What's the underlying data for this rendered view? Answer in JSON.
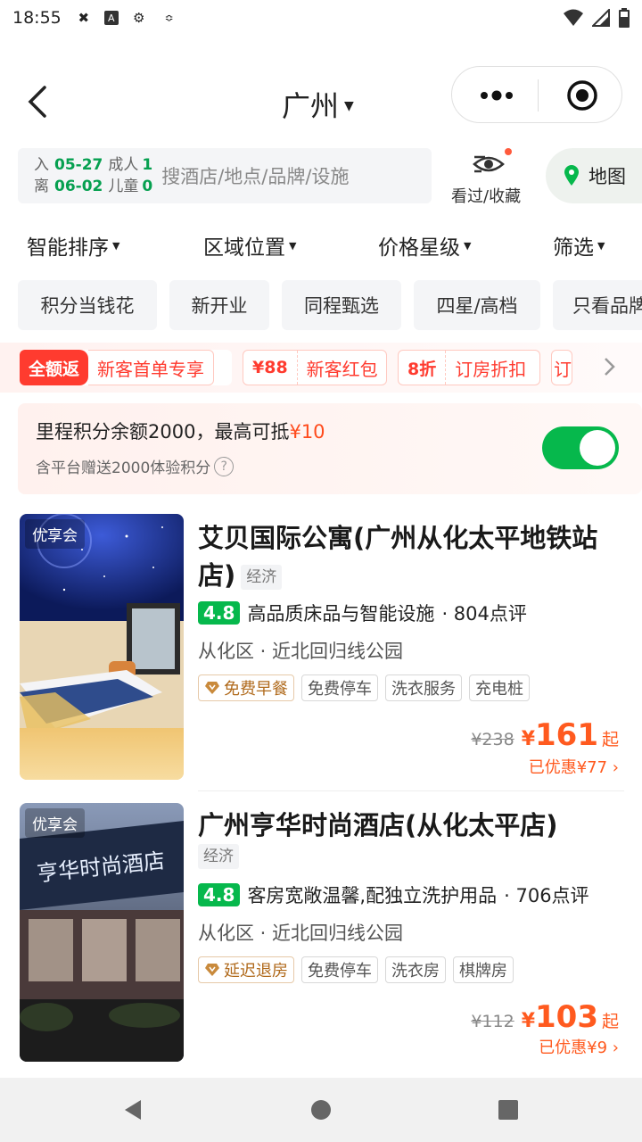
{
  "status": {
    "time": "18:55"
  },
  "header": {
    "city": "广州"
  },
  "search": {
    "checkin_label": "入",
    "checkin_date": "05-27",
    "checkout_label": "离",
    "checkout_date": "06-02",
    "adults_label": "成人",
    "adults": "1",
    "children_label": "儿童",
    "children": "0",
    "placeholder": "搜酒店/地点/品牌/设施",
    "viewed_label": "看过/收藏",
    "map_label": "地图"
  },
  "sort": [
    "智能排序",
    "区域位置",
    "价格星级",
    "筛选"
  ],
  "chips": [
    "积分当钱花",
    "新开业",
    "同程甄选",
    "四星/高档",
    "只看品牌"
  ],
  "promos": [
    {
      "tag": "全额返",
      "text": "新客首单专享"
    },
    {
      "tag": "¥88",
      "text": "新客红包"
    },
    {
      "tag": "8折",
      "text": "订房折扣"
    },
    {
      "tag": "订",
      "text": ""
    }
  ],
  "points": {
    "line1_prefix": "里程积分余额2000，最高可抵",
    "line1_amount": "¥10",
    "line2": "含平台赠送2000体验积分",
    "help": "?"
  },
  "hotels": [
    {
      "badge": "优享会",
      "name": "艾贝国际公寓(广州从化太平地铁站店)",
      "grade": "经济",
      "score": "4.8",
      "highlight": "高品质床品与智能设施",
      "reviews": "· 804点评",
      "location": "从化区 · 近北回归线公园",
      "tags": [
        "免费早餐",
        "免费停车",
        "洗衣服务",
        "充电桩"
      ],
      "old_price": "¥238",
      "price_symbol": "¥",
      "price": "161",
      "price_suffix": "起",
      "saved": "已优惠¥77"
    },
    {
      "badge": "优享会",
      "name": "广州亨华时尚酒店(从化太平店)",
      "grade": "经济",
      "score": "4.8",
      "highlight": "客房宽敞温馨,配独立洗护用品",
      "reviews": "· 706点评",
      "location": "从化区 · 近北回归线公园",
      "tags": [
        "延迟退房",
        "免费停车",
        "洗衣房",
        "棋牌房"
      ],
      "old_price": "¥112",
      "price_symbol": "¥",
      "price": "103",
      "price_suffix": "起",
      "saved": "已优惠¥9",
      "sign_text": "亨华时尚酒店"
    }
  ],
  "colors": {
    "brand_green": "#06b84c",
    "price_orange": "#ff5a1f",
    "promo_red": "#ff3b2f"
  }
}
